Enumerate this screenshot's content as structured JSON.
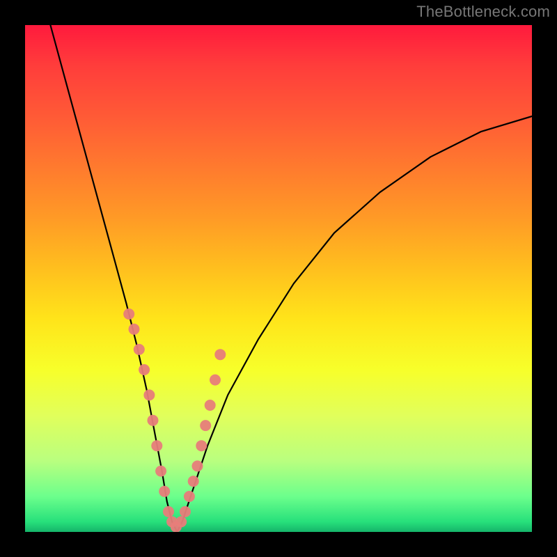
{
  "watermark": "TheBottleneck.com",
  "chart_data": {
    "type": "line",
    "title": "",
    "xlabel": "",
    "ylabel": "",
    "xlim": [
      0,
      100
    ],
    "ylim": [
      0,
      100
    ],
    "grid": false,
    "legend": false,
    "series": [
      {
        "name": "bottleneck-curve",
        "color": "#000000",
        "x": [
          5,
          8,
          11,
          14,
          17,
          20,
          22,
          24,
          25.5,
          27,
          28,
          29,
          30,
          31,
          33,
          36,
          40,
          46,
          53,
          61,
          70,
          80,
          90,
          100
        ],
        "y": [
          100,
          89,
          78,
          67,
          56,
          45,
          37,
          28,
          20,
          12,
          6,
          2,
          0,
          2,
          8,
          17,
          27,
          38,
          49,
          59,
          67,
          74,
          79,
          82
        ]
      }
    ],
    "scatter_points": {
      "name": "highlighted-points",
      "color": "#e77d7a",
      "radius_px": 8,
      "x": [
        20.5,
        21.5,
        22.5,
        23.5,
        24.5,
        25.2,
        26,
        26.8,
        27.5,
        28.3,
        29,
        29.8,
        30.8,
        31.6,
        32.4,
        33.2,
        34,
        34.8,
        35.6,
        36.5,
        37.5,
        38.5
      ],
      "y": [
        43,
        40,
        36,
        32,
        27,
        22,
        17,
        12,
        8,
        4,
        2,
        1,
        2,
        4,
        7,
        10,
        13,
        17,
        21,
        25,
        30,
        35
      ]
    },
    "background_gradient": {
      "type": "vertical",
      "stops": [
        {
          "pos": 0.0,
          "color": "#ff1a3d"
        },
        {
          "pos": 0.5,
          "color": "#ffd020"
        },
        {
          "pos": 0.75,
          "color": "#f3ff40"
        },
        {
          "pos": 1.0,
          "color": "#15b46a"
        }
      ]
    }
  }
}
